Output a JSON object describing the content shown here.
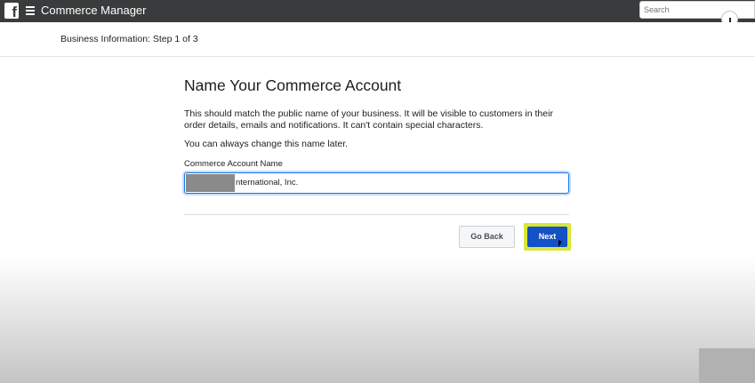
{
  "topbar": {
    "logo_letter": "f",
    "app_title": "Commerce Manager",
    "search_placeholder": "Search"
  },
  "subheader": {
    "step_label": "Business Information: Step 1 of 3"
  },
  "form": {
    "title": "Name Your Commerce Account",
    "description": "This should match the public name of your business. It will be visible to customers in their order details, emails and notifications. It can't contain special characters.",
    "note": "You can always change this name later.",
    "field_label": "Commerce Account Name",
    "field_value": "nternational, Inc."
  },
  "actions": {
    "back_label": "Go Back",
    "next_label": "Next"
  },
  "colors": {
    "topbar": "#3a3b3c",
    "primary_button": "#1251c6",
    "highlight": "#d7e63a",
    "input_focus": "#1877f2"
  }
}
